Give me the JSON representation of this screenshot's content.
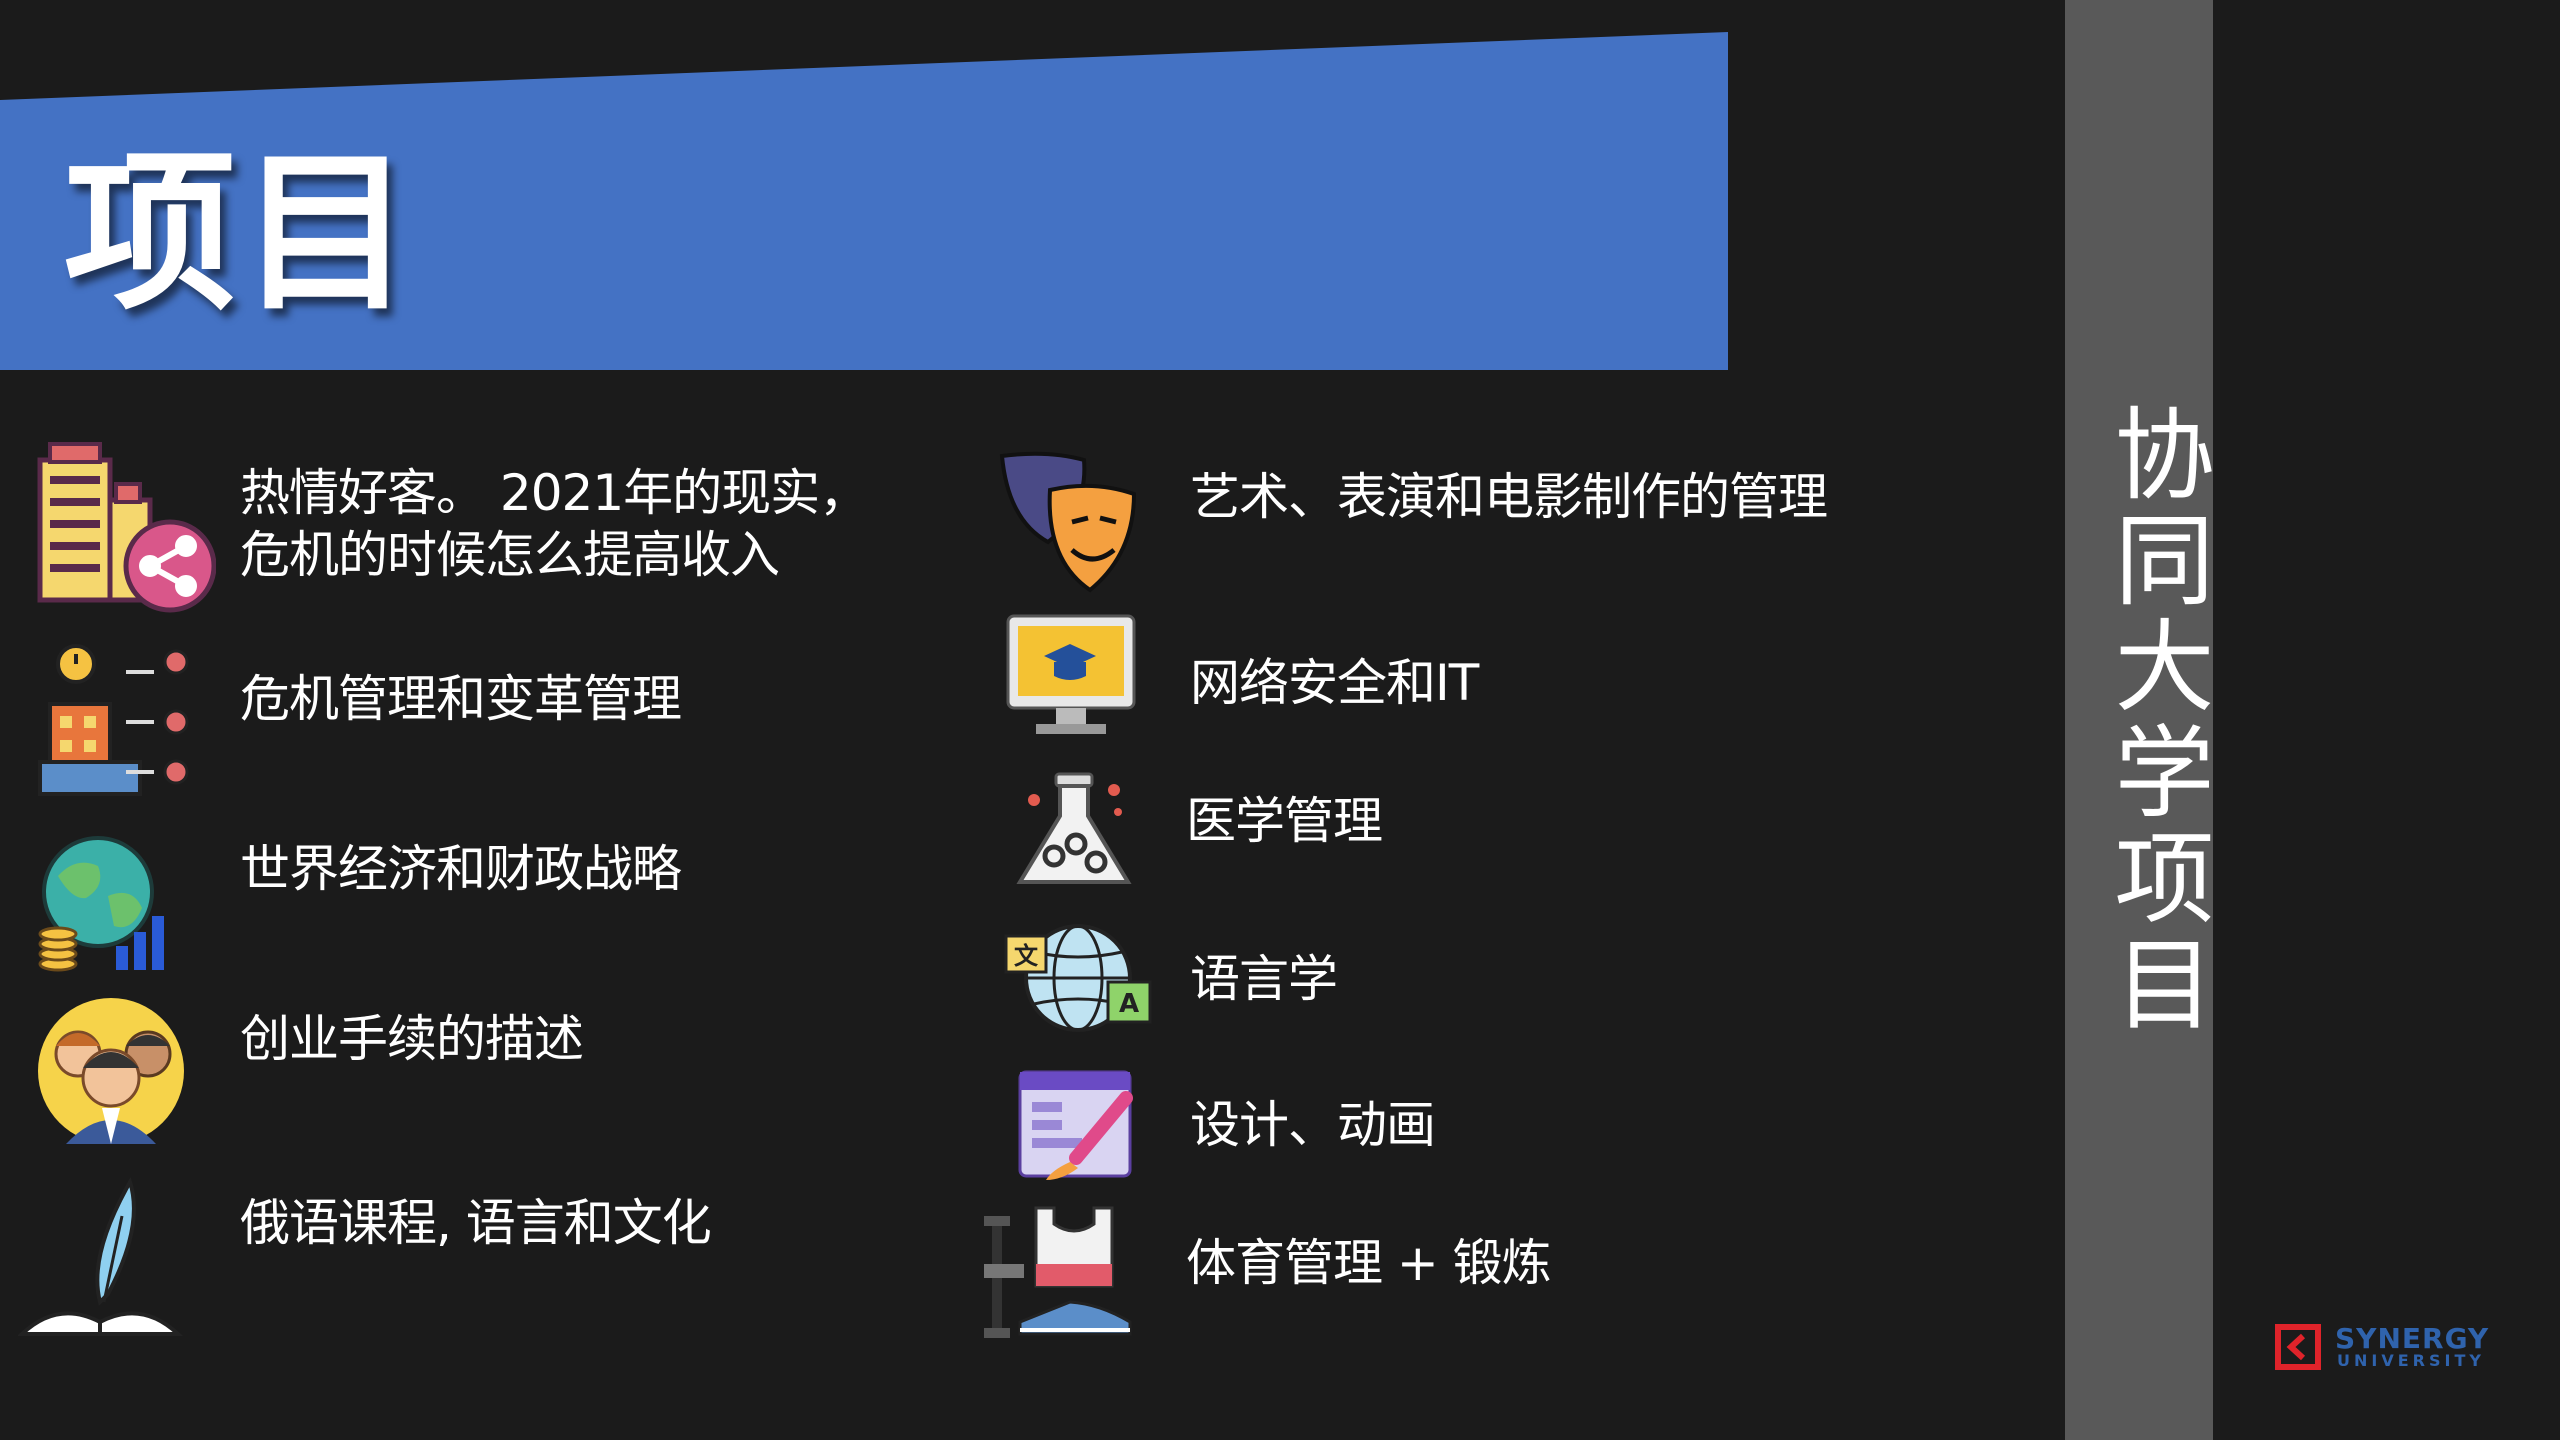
{
  "header": {
    "title": "项目"
  },
  "sidebar": {
    "title": "协同大学项目"
  },
  "programs_left": [
    {
      "label": "热情好客。 2021年的现实， 危机的时候怎么提高收入",
      "icon": "hotel-share-icon"
    },
    {
      "label": "危机管理和变革管理",
      "icon": "crisis-management-icon"
    },
    {
      "label": "世界经济和财政战略",
      "icon": "globe-finance-icon"
    },
    {
      "label": "创业手续的描述",
      "icon": "business-team-icon"
    },
    {
      "label": "俄语课程, 语言和文化",
      "icon": "quill-book-icon"
    }
  ],
  "programs_right": [
    {
      "label": "艺术、表演和电影制作的管理",
      "icon": "theater-masks-icon"
    },
    {
      "label": "网络安全和IT",
      "icon": "online-education-monitor-icon"
    },
    {
      "label": "医学管理",
      "icon": "lab-flask-icon"
    },
    {
      "label": "语言学",
      "icon": "language-globe-icon"
    },
    {
      "label": "设计、动画",
      "icon": "design-brush-icon"
    },
    {
      "label": "体育管理 + 锻炼",
      "icon": "sports-fitness-icon"
    }
  ],
  "logo": {
    "name": "SYNERGY",
    "sub": "UNIVERSITY"
  },
  "colors": {
    "background": "#1b1b1b",
    "banner": "#4472c4",
    "side_band": "#595959",
    "text": "#ffffff",
    "logo_red": "#e0232a",
    "logo_blue": "#2f63ad"
  }
}
